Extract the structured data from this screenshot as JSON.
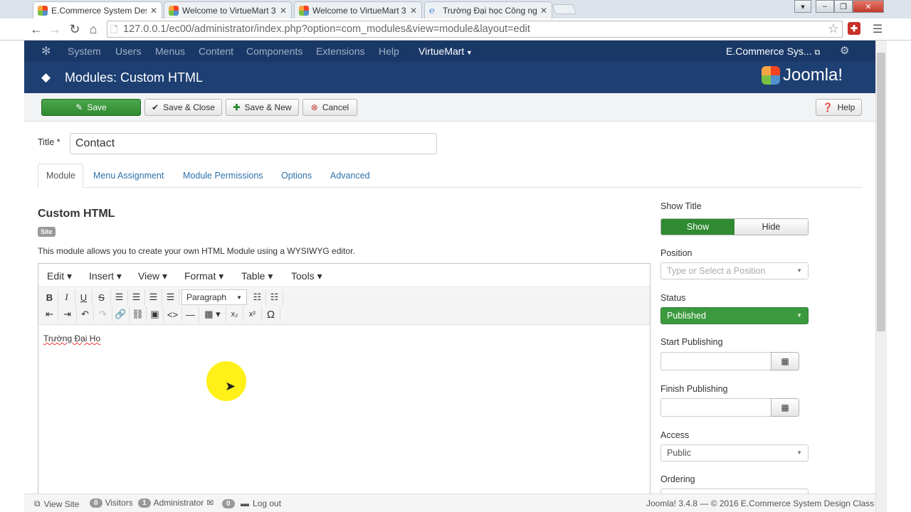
{
  "browser": {
    "tabs": [
      {
        "title": "E.Commerce System Desig",
        "active": true
      },
      {
        "title": "Welcome to VirtueMart 3",
        "active": false
      },
      {
        "title": "Welcome to VirtueMart 3",
        "active": false
      },
      {
        "title": "Trường Đại học Công ngh",
        "active": false
      }
    ],
    "url": "127.0.0.1/ec00/administrator/index.php?option=com_modules&view=module&layout=edit"
  },
  "joomla_nav": {
    "items": [
      "System",
      "Users",
      "Menus",
      "Content",
      "Components",
      "Extensions",
      "Help"
    ],
    "virtuemart": "VirtueMart",
    "site_name": "E.Commerce Sys...",
    "brand": "Joomla!"
  },
  "page": {
    "title": "Modules: Custom HTML"
  },
  "toolbar": {
    "save": "Save",
    "save_close": "Save & Close",
    "save_new": "Save & New",
    "cancel": "Cancel",
    "help": "Help"
  },
  "form": {
    "title_label": "Title *",
    "title_value": "Contact",
    "tabs": [
      "Module",
      "Menu Assignment",
      "Module Permissions",
      "Options",
      "Advanced"
    ],
    "active_tab": "Module",
    "module_heading": "Custom HTML",
    "site_badge": "Site",
    "description": "This module allows you to create your own HTML Module using a WYSIWYG editor."
  },
  "editor": {
    "menus": [
      "Edit",
      "Insert",
      "View",
      "Format",
      "Table",
      "Tools"
    ],
    "paragraph": "Paragraph",
    "content": "Trường Đại Ho"
  },
  "sidebar": {
    "show_title_label": "Show Title",
    "show": "Show",
    "hide": "Hide",
    "position_label": "Position",
    "position_placeholder": "Type or Select a Position",
    "status_label": "Status",
    "status_value": "Published",
    "start_label": "Start Publishing",
    "finish_label": "Finish Publishing",
    "access_label": "Access",
    "access_value": "Public",
    "ordering_label": "Ordering"
  },
  "statusbar": {
    "view_site": "View Site",
    "visitors_count": "0",
    "visitors": "Visitors",
    "admin_count": "1",
    "administrator": "Administrator",
    "messages_count": "0",
    "logout": "Log out",
    "footer": "Joomla! 3.4.8 — © 2016 E.Commerce System Design Class"
  },
  "colors": {
    "nav_bg": "#1a3867",
    "title_bg": "#1d3f72",
    "green": "#2f8a31",
    "link": "#3071a9"
  }
}
